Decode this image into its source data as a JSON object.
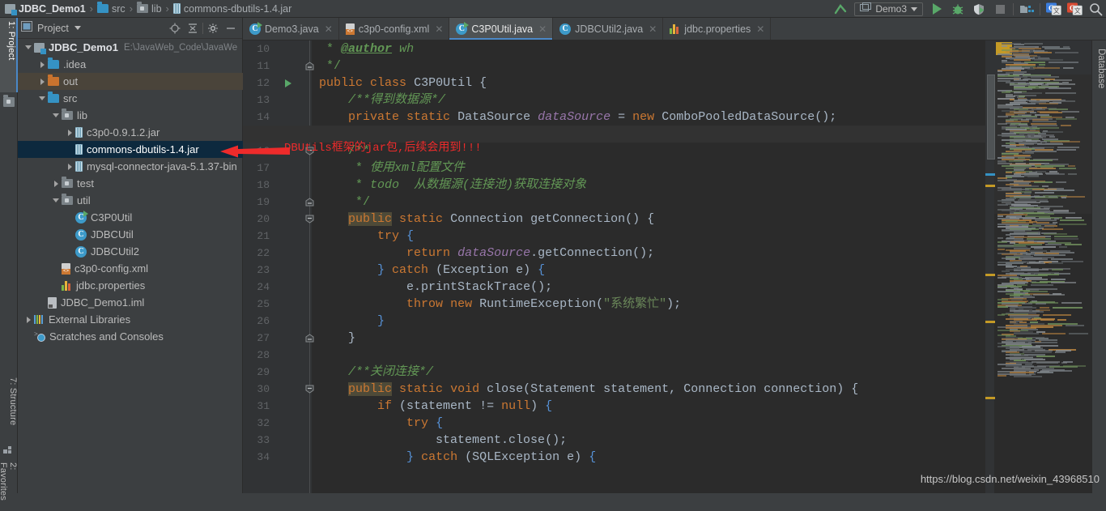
{
  "breadcrumb": [
    {
      "label": "JDBC_Demo1",
      "icon": "module-icon"
    },
    {
      "label": "src",
      "icon": "folder-icon"
    },
    {
      "label": "lib",
      "icon": "folder-lib-icon"
    },
    {
      "label": "commons-dbutils-1.4.jar",
      "icon": "jar-icon"
    }
  ],
  "toolbar": {
    "run_config": "Demo3",
    "buttons": [
      "back-icon",
      "run-icon",
      "debug-icon",
      "coverage-icon",
      "stop-icon",
      "project-structure-icon",
      "translate-g-icon",
      "translate-red-icon",
      "search-icon"
    ]
  },
  "left_rail": {
    "tabs": [
      {
        "label": "1: Project",
        "active": true
      },
      {
        "label": "7: Structure",
        "active": false
      },
      {
        "label": "2: Favorites",
        "active": false
      }
    ]
  },
  "right_rail": {
    "tabs": [
      {
        "label": "Database"
      }
    ]
  },
  "project_panel": {
    "title": "Project",
    "header_icons": [
      "locate-icon",
      "collapse-all-icon",
      "gear-icon",
      "hide-icon"
    ],
    "tree": [
      {
        "depth": 0,
        "twisty": "down",
        "icon": "module-icon",
        "label": "JDBC_Demo1",
        "sub": "E:\\JavaWeb_Code\\JavaWe",
        "bold": true
      },
      {
        "depth": 1,
        "twisty": "right",
        "icon": "folder-icon",
        "label": ".idea"
      },
      {
        "depth": 1,
        "twisty": "right",
        "icon": "out-folder-icon",
        "label": "out",
        "row": "out"
      },
      {
        "depth": 1,
        "twisty": "down",
        "icon": "folder-icon",
        "label": "src"
      },
      {
        "depth": 2,
        "twisty": "down",
        "icon": "folder-lib-icon",
        "label": "lib"
      },
      {
        "depth": 3,
        "twisty": "right",
        "icon": "jar-icon",
        "label": "c3p0-0.9.1.2.jar"
      },
      {
        "depth": 3,
        "twisty": "none",
        "icon": "jar-icon",
        "label": "commons-dbutils-1.4.jar",
        "row": "sel"
      },
      {
        "depth": 3,
        "twisty": "right",
        "icon": "jar-icon",
        "label": "mysql-connector-java-5.1.37-bin"
      },
      {
        "depth": 2,
        "twisty": "right",
        "icon": "folder-lib-icon",
        "label": "test"
      },
      {
        "depth": 2,
        "twisty": "down",
        "icon": "folder-lib-icon",
        "label": "util"
      },
      {
        "depth": 3,
        "twisty": "none",
        "icon": "class-run-icon",
        "label": "C3P0Util"
      },
      {
        "depth": 3,
        "twisty": "none",
        "icon": "class-icon",
        "label": "JDBCUtil"
      },
      {
        "depth": 3,
        "twisty": "none",
        "icon": "class-icon",
        "label": "JDBCUtil2"
      },
      {
        "depth": 2,
        "twisty": "none",
        "icon": "xml-icon",
        "label": "c3p0-config.xml"
      },
      {
        "depth": 2,
        "twisty": "none",
        "icon": "properties-icon",
        "label": "jdbc.properties"
      },
      {
        "depth": 1,
        "twisty": "none",
        "icon": "iml-icon",
        "label": "JDBC_Demo1.iml"
      },
      {
        "depth": 0,
        "twisty": "right",
        "icon": "ext-lib-icon",
        "label": "External Libraries"
      },
      {
        "depth": 0,
        "twisty": "none",
        "icon": "scratch-icon",
        "label": "Scratches and Consoles"
      }
    ]
  },
  "editor_tabs": [
    {
      "label": "Demo3.java",
      "icon": "class-run-icon",
      "active": false
    },
    {
      "label": "c3p0-config.xml",
      "icon": "xml-icon",
      "active": false
    },
    {
      "label": "C3P0Util.java",
      "icon": "class-run-icon",
      "active": true
    },
    {
      "label": "JDBCUtil2.java",
      "icon": "class-icon",
      "active": false
    },
    {
      "label": "jdbc.properties",
      "icon": "properties-icon",
      "active": false
    }
  ],
  "editor": {
    "first_line": 10,
    "current_line": 15,
    "run_marker_line": 12,
    "folds": [
      {
        "line": 11,
        "type": "end"
      },
      {
        "line": 16,
        "type": "start"
      },
      {
        "line": 19,
        "type": "end"
      },
      {
        "line": 20,
        "type": "start"
      },
      {
        "line": 27,
        "type": "end"
      },
      {
        "line": 30,
        "type": "start"
      }
    ],
    "lines": [
      {
        "n": 10,
        "html": "  <span class='cmtb'>*</span> <span class='doctag'>@author</span> <span class='cmt'>wh</span>"
      },
      {
        "n": 11,
        "html": "  <span class='cmtb'>*/</span>"
      },
      {
        "n": 12,
        "html": " <span class='kw'>public</span> <span class='kw'>class</span> <span class='typ'>C3P0Util</span> <span class='br'>{</span>"
      },
      {
        "n": 13,
        "html": "     <span class='cmt'>/**得到数据源*/</span>"
      },
      {
        "n": 14,
        "html": "     <span class='kw'>private</span> <span class='kw'>static</span> <span class='typ'>DataSource</span> <span class='fld'>dataSource</span> <span class='pl'>=</span> <span class='kw'>new</span> <span class='typ'>ComboPooledDataSource</span><span class='pl'>();</span>"
      },
      {
        "n": 15,
        "html": ""
      },
      {
        "n": 16,
        "html": "     <span class='cmtb'>/**</span>"
      },
      {
        "n": 17,
        "html": "      <span class='cmtb'>*</span> <span class='cmt'>使用xml配置文件</span>"
      },
      {
        "n": 18,
        "html": "      <span class='cmtb'>*</span> <span class='cmt'>todo  从数据源(连接池)获取连接对象</span>"
      },
      {
        "n": 19,
        "html": "      <span class='cmtb'>*/</span>"
      },
      {
        "n": 20,
        "html": "     <span class='kw hl'>public</span> <span class='kw'>static</span> <span class='typ'>Connection</span> <span class='mth'>getConnection</span><span class='pl'>()</span> <span class='br'>{</span>"
      },
      {
        "n": 21,
        "html": "         <span class='kw'>try</span> <span class='brace-b'>{</span>"
      },
      {
        "n": 22,
        "html": "             <span class='kw'>return</span> <span class='fld'>dataSource</span><span class='pl'>.</span><span class='mth'>getConnection</span><span class='pl'>();</span>"
      },
      {
        "n": 23,
        "html": "         <span class='brace-b'>}</span> <span class='kw'>catch</span> <span class='pl'>(</span><span class='typ'>Exception</span> <span class='pl'>e)</span> <span class='brace-b'>{</span>"
      },
      {
        "n": 24,
        "html": "             <span class='pl'>e.</span><span class='mth'>printStackTrace</span><span class='pl'>();</span>"
      },
      {
        "n": 25,
        "html": "             <span class='kw'>throw</span> <span class='kw'>new</span> <span class='typ'>RuntimeException</span><span class='pl'>(</span><span class='str'>\"系统繁忙\"</span><span class='pl'>);</span>"
      },
      {
        "n": 26,
        "html": "         <span class='brace-b'>}</span>"
      },
      {
        "n": 27,
        "html": "     <span class='br'>}</span>"
      },
      {
        "n": 28,
        "html": ""
      },
      {
        "n": 29,
        "html": "     <span class='cmt'>/**关闭连接*/</span>"
      },
      {
        "n": 30,
        "html": "     <span class='kw hl'>public</span> <span class='kw'>static</span> <span class='kw'>void</span> <span class='mth'>close</span><span class='pl'>(</span><span class='typ'>Statement</span> <span class='pl'>statement,</span> <span class='typ'>Connection</span> <span class='pl'>connection)</span> <span class='br'>{</span>"
      },
      {
        "n": 31,
        "html": "         <span class='kw'>if</span> <span class='pl'>(statement</span> <span class='pl'>!=</span> <span class='kw'>null</span><span class='pl'>)</span> <span class='brace-b'>{</span>"
      },
      {
        "n": 32,
        "html": "             <span class='kw'>try</span> <span class='brace-b'>{</span>"
      },
      {
        "n": 33,
        "html": "                 <span class='pl'>statement.</span><span class='mth'>close</span><span class='pl'>();</span>"
      },
      {
        "n": 34,
        "html": "             <span class='brace-b'>}</span> <span class='kw'>catch</span> <span class='pl'>(</span><span class='typ'>SQLException</span> <span class='pl'>e)</span> <span class='brace-b'>{</span>"
      }
    ]
  },
  "annotation": {
    "text": "DBUtils框架的jar包,后续会用到!!!",
    "color": "#ee2b2b",
    "arrow": "left-arrow-annotation"
  },
  "watermark": "https://blog.csdn.net/weixin_43968510",
  "colors": {
    "accent": "#4a88c7",
    "selection": "#0d293e",
    "editor_bg": "#2b2b2b",
    "panel_bg": "#3c3f41",
    "gutter_bg": "#313335"
  }
}
